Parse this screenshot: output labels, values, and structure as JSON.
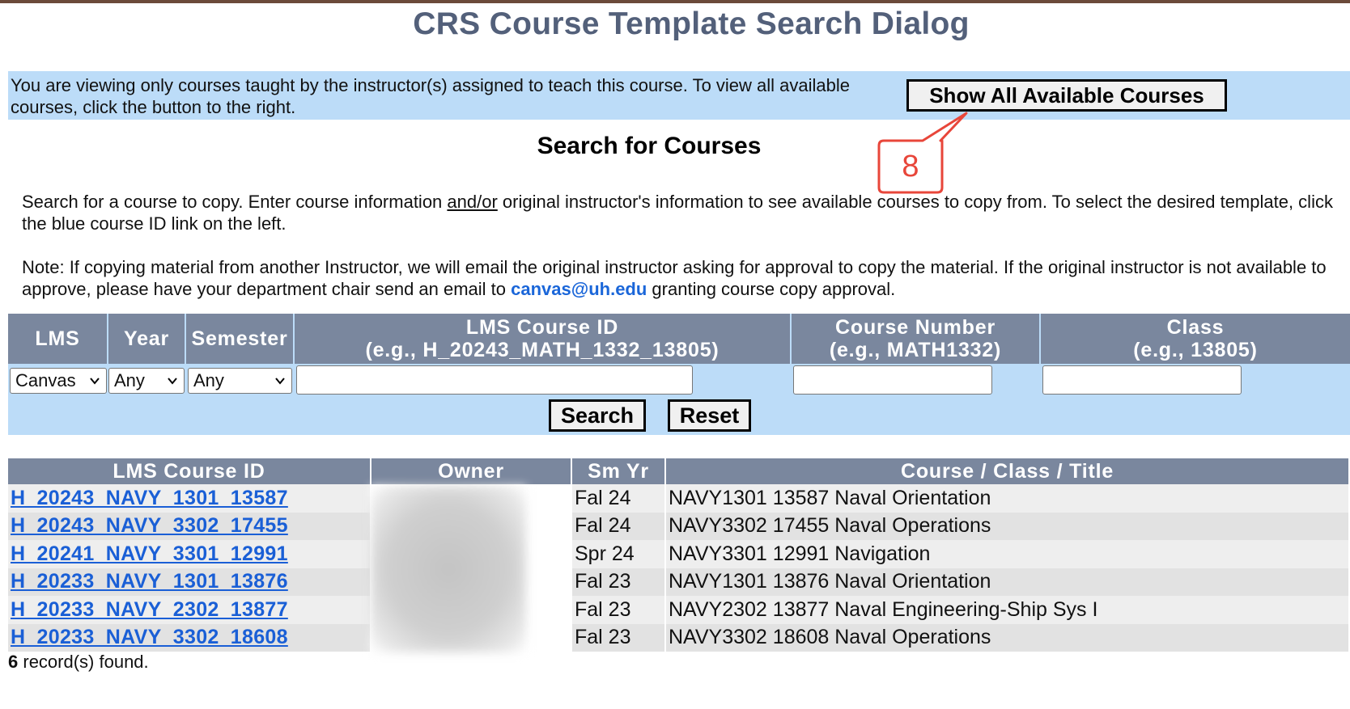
{
  "page": {
    "title": "CRS Course Template Search Dialog"
  },
  "notice": {
    "text": "You are viewing only courses taught by the instructor(s) assigned to teach this course. To view all available courses, click the button to the right.",
    "show_all_button": "Show All Available Courses"
  },
  "annotation": {
    "number": "8",
    "color": "#e8463a"
  },
  "search": {
    "heading": "Search for Courses",
    "desc_part1": "Search for a course to copy. Enter course information ",
    "desc_underlined": "and/or",
    "desc_part2": " original instructor's information to see available courses to copy from. To select the desired template, click the blue course ID link on the left.",
    "note_part1": "Note: If copying material from another Instructor, we will email the original instructor asking for approval to copy the material. If the original instructor is not available to approve, please have your department chair send an email to ",
    "note_email": "canvas@uh.edu",
    "note_part2": " granting course copy approval.",
    "columns": {
      "lms": "LMS",
      "year": "Year",
      "semester": "Semester",
      "course_id": "LMS Course ID",
      "course_id_hint": "(e.g., H_20243_MATH_1332_13805)",
      "course_number": "Course Number",
      "course_number_hint": "(e.g., MATH1332)",
      "class": "Class",
      "class_hint": "(e.g., 13805)"
    },
    "lms_selected": "Canvas",
    "year_selected": "Any",
    "semester_selected": "Any",
    "course_id_value": "",
    "course_number_value": "",
    "class_value": "",
    "search_button": "Search",
    "reset_button": "Reset"
  },
  "results": {
    "headers": {
      "course_id": "LMS Course ID",
      "owner": "Owner",
      "sm_yr": "Sm Yr",
      "title": "Course / Class / Title"
    },
    "rows": [
      {
        "course_id": "H_20243_NAVY_1301_13587",
        "sm_yr": "Fal 24",
        "title": "NAVY1301 13587 Naval Orientation"
      },
      {
        "course_id": "H_20243_NAVY_3302_17455",
        "sm_yr": "Fal 24",
        "title": "NAVY3302 17455 Naval Operations"
      },
      {
        "course_id": "H_20241_NAVY_3301_12991",
        "sm_yr": "Spr 24",
        "title": "NAVY3301 12991 Navigation"
      },
      {
        "course_id": "H_20233_NAVY_1301_13876",
        "sm_yr": "Fal 23",
        "title": "NAVY1301 13876 Naval Orientation"
      },
      {
        "course_id": "H_20233_NAVY_2302_13877",
        "sm_yr": "Fal 23",
        "title": "NAVY2302 13877 Naval Engineering-Ship Sys I"
      },
      {
        "course_id": "H_20233_NAVY_3302_18608",
        "sm_yr": "Fal 23",
        "title": "NAVY3302 18608 Naval Operations"
      }
    ],
    "count": "6",
    "count_suffix": " record(s) found."
  },
  "colors": {
    "title": "#53607a",
    "header_bg": "#7a879e",
    "panel_bg": "#bcdcf8",
    "link": "#1a5fd6"
  }
}
